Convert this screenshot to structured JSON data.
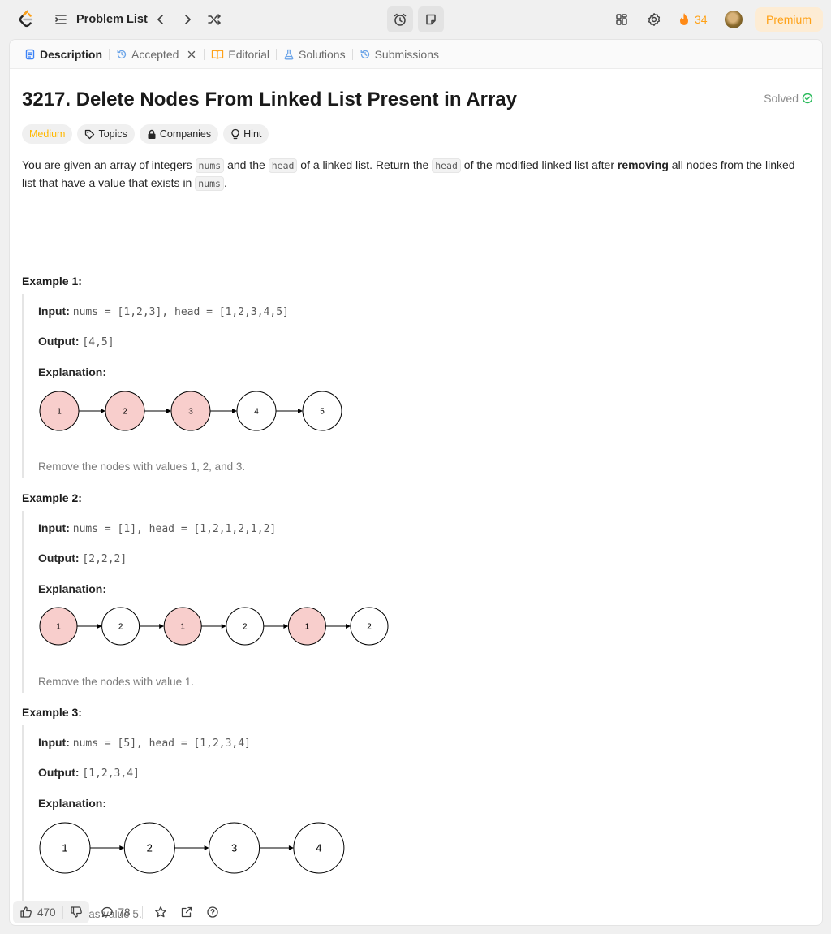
{
  "topbar": {
    "problem_list_label": "Problem List",
    "streak_count": "34",
    "premium_label": "Premium",
    "accent_color": "#ffa116"
  },
  "tabs": [
    {
      "label": "Description",
      "icon": "document-icon",
      "active": true
    },
    {
      "label": "Accepted",
      "icon": "history-icon",
      "closable": true
    },
    {
      "label": "Editorial",
      "icon": "book-icon"
    },
    {
      "label": "Solutions",
      "icon": "flask-icon"
    },
    {
      "label": "Submissions",
      "icon": "history-icon"
    }
  ],
  "problem": {
    "title": "3217. Delete Nodes From Linked List Present in Array",
    "status": "Solved",
    "difficulty": "Medium",
    "tags": [
      "Topics",
      "Companies",
      "Hint"
    ],
    "description": {
      "p1": "You are given an array of integers ",
      "c1": "nums",
      "p2": " and the ",
      "c2": "head",
      "p3": " of a linked list. Return the ",
      "c3": "head",
      "p4": " of the modified linked list after ",
      "bold": "removing",
      "p5": " all nodes from the linked list that have a value that exists in ",
      "c4": "nums",
      "p6": "."
    }
  },
  "labels": {
    "input": "Input:",
    "output": "Output:",
    "explanation": "Explanation:"
  },
  "examples": [
    {
      "heading": "Example 1:",
      "input": "nums = [1,2,3], head = [1,2,3,4,5]",
      "output": "[4,5]",
      "nodes": [
        1,
        2,
        3,
        4,
        5
      ],
      "removed": [
        true,
        true,
        true,
        false,
        false
      ],
      "note": "Remove the nodes with values 1, 2, and 3."
    },
    {
      "heading": "Example 2:",
      "input": "nums = [1], head = [1,2,1,2,1,2]",
      "output": "[2,2,2]",
      "nodes": [
        1,
        2,
        1,
        2,
        1,
        2
      ],
      "removed": [
        true,
        false,
        true,
        false,
        true,
        false
      ],
      "note": "Remove the nodes with value 1."
    },
    {
      "heading": "Example 3:",
      "input": "nums = [5], head = [1,2,3,4]",
      "output": "[1,2,3,4]",
      "nodes": [
        1,
        2,
        3,
        4
      ],
      "removed": [
        false,
        false,
        false,
        false
      ],
      "note": "No node has value 5."
    }
  ],
  "footer": {
    "likes": "470",
    "comments": "78"
  },
  "colors": {
    "removed_node_fill": "#f8cecc",
    "kept_node_fill": "#ffffff",
    "difficulty_medium": "#ffb800",
    "solved_check": "#2cbb5d"
  }
}
